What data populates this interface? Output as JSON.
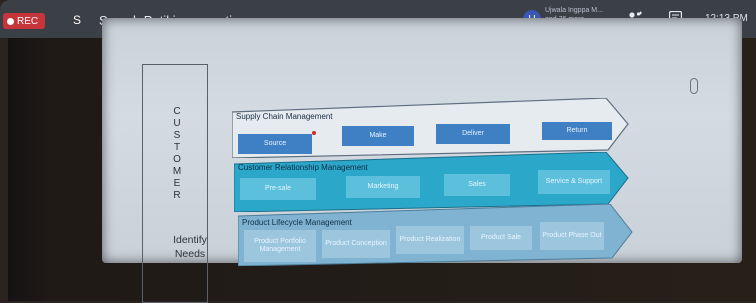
{
  "topbar": {
    "rec_label": "REC",
    "self_avatar": "S",
    "presenter_text": "Suresh Patil is presenting",
    "participant_avatar": "U",
    "participants_line1": "Ujwala Ingppa M...",
    "participants_line2": "and 76 more",
    "clock": "12:13 PM",
    "icons": [
      "people-icon",
      "chat-icon"
    ]
  },
  "slide": {
    "customer_letters": [
      "C",
      "U",
      "S",
      "T",
      "O",
      "M",
      "E",
      "R"
    ],
    "identify_line1": "Identify",
    "identify_line2": "Needs",
    "bands": [
      {
        "title": "Supply Chain Management",
        "boxes": [
          "Source",
          "Make",
          "Deliver",
          "Return"
        ]
      },
      {
        "title": "Customer Relationship Management",
        "boxes": [
          "Pre-sale",
          "Marketing",
          "Sales",
          "Service & Support"
        ]
      },
      {
        "title": "Product Lifecycle Management",
        "boxes": [
          "Product Portfolio Management",
          "Product Conception",
          "Product Realization",
          "Product Sale",
          "Product Phase Out"
        ]
      }
    ]
  },
  "colors": {
    "rec": "#c6353a",
    "topbar": "#3b3f46",
    "band1": "#e6ebf0",
    "band2": "#2aa7c9",
    "band3": "#7fb3d1"
  }
}
